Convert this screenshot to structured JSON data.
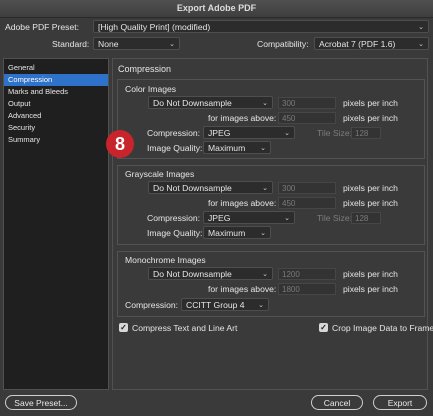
{
  "window": {
    "title": "Export Adobe PDF"
  },
  "header": {
    "preset_label": "Adobe PDF Preset:",
    "preset_value": "[High Quality Print] (modified)",
    "standard_label": "Standard:",
    "standard_value": "None",
    "compat_label": "Compatibility:",
    "compat_value": "Acrobat 7 (PDF 1.6)"
  },
  "sidebar": {
    "items": [
      {
        "label": "General"
      },
      {
        "label": "Compression"
      },
      {
        "label": "Marks and Bleeds"
      },
      {
        "label": "Output"
      },
      {
        "label": "Advanced"
      },
      {
        "label": "Security"
      },
      {
        "label": "Summary"
      }
    ],
    "selected": "Compression"
  },
  "badge": "8",
  "panel": {
    "title": "Compression",
    "color": {
      "title": "Color Images",
      "downsample": "Do Not Downsample",
      "ppi1": "300",
      "ppi_unit": "pixels per inch",
      "above_label": "for images above:",
      "ppi2": "450",
      "compression_label": "Compression:",
      "compression": "JPEG",
      "tile_label": "Tile Size:",
      "tile": "128",
      "quality_label": "Image Quality:",
      "quality": "Maximum"
    },
    "gray": {
      "title": "Grayscale Images",
      "downsample": "Do Not Downsample",
      "ppi1": "300",
      "ppi_unit": "pixels per inch",
      "above_label": "for images above:",
      "ppi2": "450",
      "compression_label": "Compression:",
      "compression": "JPEG",
      "tile_label": "Tile Size:",
      "tile": "128",
      "quality_label": "Image Quality:",
      "quality": "Maximum"
    },
    "mono": {
      "title": "Monochrome Images",
      "downsample": "Do Not Downsample",
      "ppi1": "1200",
      "ppi_unit": "pixels per inch",
      "above_label": "for images above:",
      "ppi2": "1800",
      "compression_label": "Compression:",
      "compression": "CCITT Group 4"
    },
    "compress_text": {
      "label": "Compress Text and Line Art",
      "checked": true
    },
    "crop_data": {
      "label": "Crop Image Data to Frames",
      "checked": true
    }
  },
  "footer": {
    "save_preset": "Save Preset...",
    "cancel": "Cancel",
    "export": "Export"
  },
  "colors": {
    "accent": "#2f72c9",
    "badge": "#c8242b",
    "window_bg": "#3a3a3a"
  }
}
